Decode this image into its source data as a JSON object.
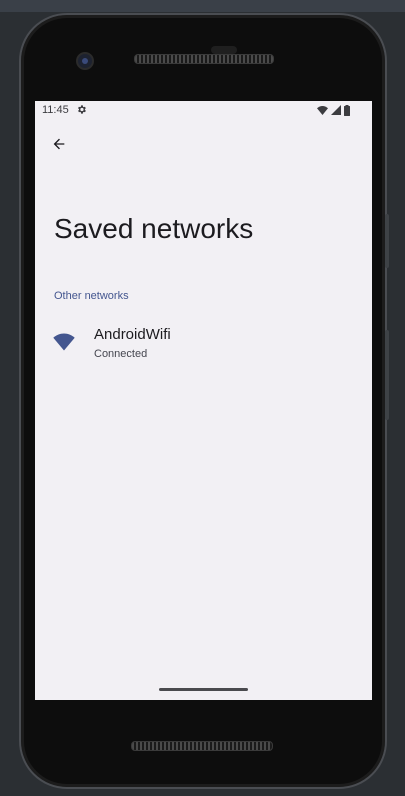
{
  "status_bar": {
    "time": "11:45",
    "settings_icon": "gear-icon",
    "icons": [
      "wifi-signal-icon",
      "cell-signal-icon",
      "battery-icon"
    ]
  },
  "toolbar": {
    "back_icon": "arrow-back-icon"
  },
  "page": {
    "title": "Saved networks"
  },
  "sections": [
    {
      "header": "Other networks",
      "networks": [
        {
          "name": "AndroidWifi",
          "status": "Connected",
          "icon": "wifi-icon"
        }
      ]
    }
  ],
  "colors": {
    "accent": "#44568f",
    "screen_bg": "#f2f0f4",
    "title_text": "#1c1b1f"
  }
}
